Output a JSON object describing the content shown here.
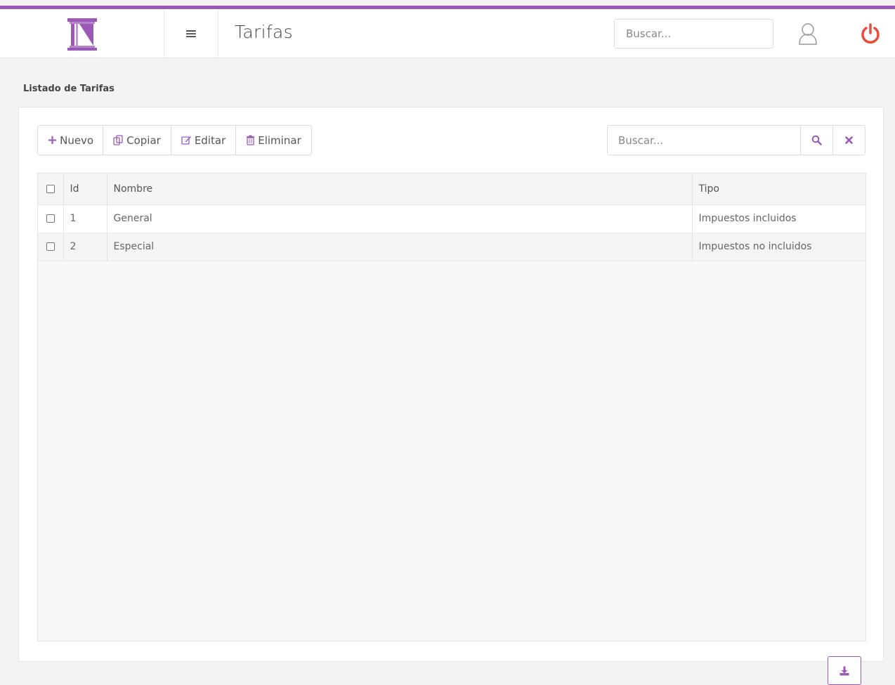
{
  "colors": {
    "accent": "#9b59b6",
    "power": "#e74c3c"
  },
  "header": {
    "title": "Tarifas",
    "search_placeholder": "Buscar...",
    "logo_icon": "column-logo-icon",
    "menu_icon": "hamburger-icon",
    "user_icon": "user-icon",
    "power_icon": "power-icon",
    "menu_glyph": "≡"
  },
  "section": {
    "label": "Listado de Tarifas"
  },
  "toolbar": {
    "nuevo_label": "Nuevo",
    "copiar_label": "Copiar",
    "editar_label": "Editar",
    "eliminar_label": "Eliminar"
  },
  "search": {
    "placeholder": "Buscar..."
  },
  "table": {
    "columns": [
      "Id",
      "Nombre",
      "Tipo"
    ],
    "rows": [
      {
        "id": "1",
        "nombre": "General",
        "tipo": "Impuestos incluidos"
      },
      {
        "id": "2",
        "nombre": "Especial",
        "tipo": "Impuestos no incluidos"
      }
    ]
  }
}
